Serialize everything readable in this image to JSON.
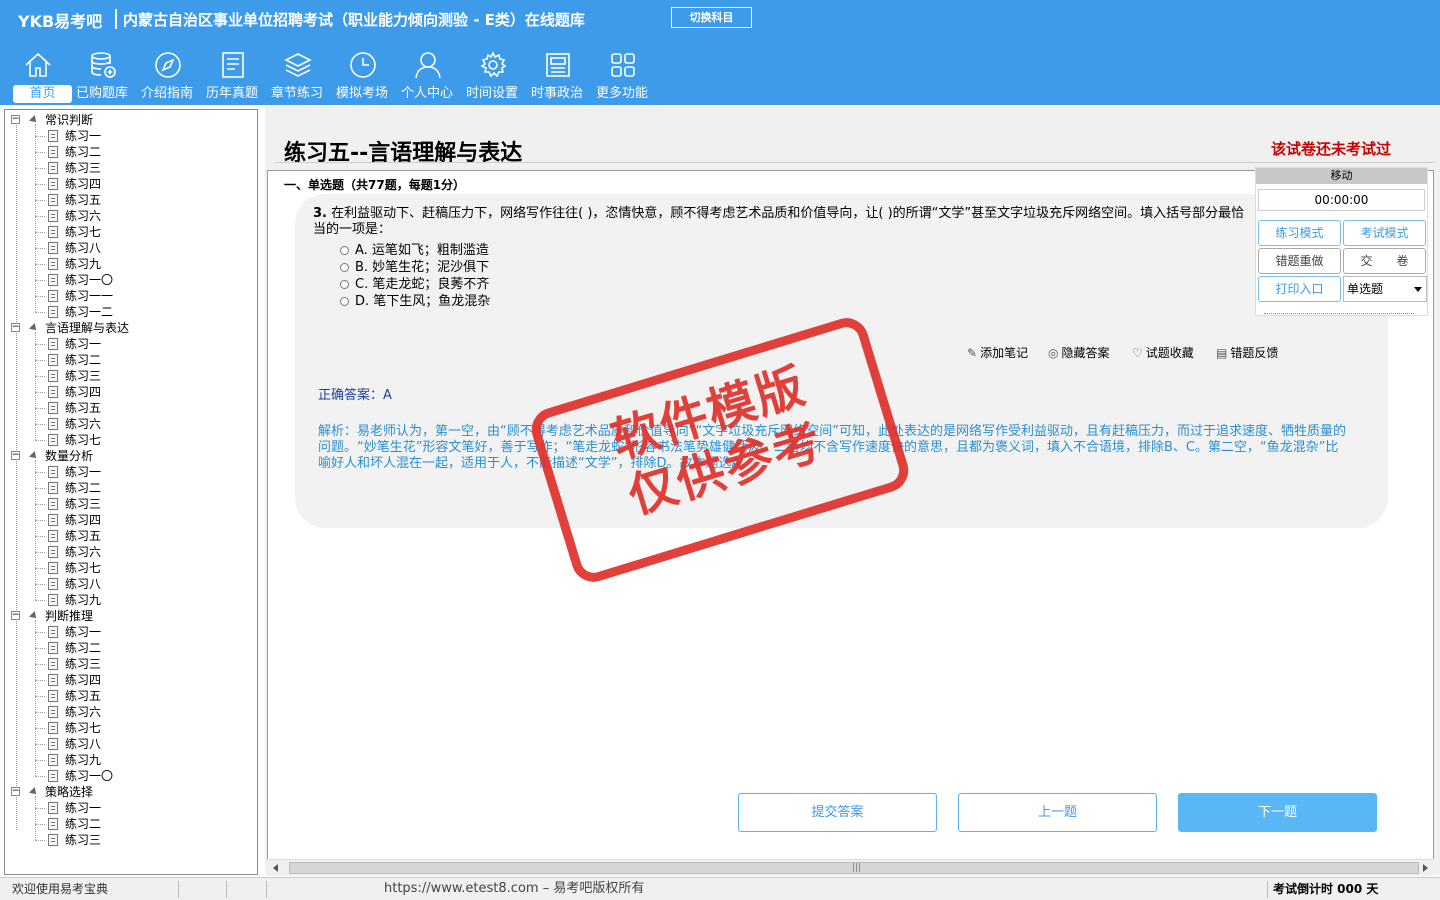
{
  "header": {
    "brand": "YKB易考吧",
    "title": "内蒙古自治区事业单位招聘考试（职业能力倾向测验 - E类）在线题库",
    "switch_label": "切换科目"
  },
  "nav": [
    {
      "label": "首页",
      "icon": "home-icon"
    },
    {
      "label": "已购题库",
      "icon": "database-icon"
    },
    {
      "label": "介绍指南",
      "icon": "compass-icon"
    },
    {
      "label": "历年真题",
      "icon": "list-doc-icon"
    },
    {
      "label": "章节练习",
      "icon": "layers-icon"
    },
    {
      "label": "模拟考场",
      "icon": "clock-icon"
    },
    {
      "label": "个人中心",
      "icon": "user-icon"
    },
    {
      "label": "时间设置",
      "icon": "gear-icon"
    },
    {
      "label": "时事政治",
      "icon": "news-icon"
    },
    {
      "label": "更多功能",
      "icon": "grid-icon"
    }
  ],
  "tree": [
    {
      "name": "常识判断",
      "children": [
        "练习一",
        "练习二",
        "练习三",
        "练习四",
        "练习五",
        "练习六",
        "练习七",
        "练习八",
        "练习九",
        "练习一〇",
        "练习一一",
        "练习一二"
      ]
    },
    {
      "name": "言语理解与表达",
      "children": [
        "练习一",
        "练习二",
        "练习三",
        "练习四",
        "练习五",
        "练习六",
        "练习七"
      ]
    },
    {
      "name": "数量分析",
      "children": [
        "练习一",
        "练习二",
        "练习三",
        "练习四",
        "练习五",
        "练习六",
        "练习七",
        "练习八",
        "练习九"
      ]
    },
    {
      "name": "判断推理",
      "children": [
        "练习一",
        "练习二",
        "练习三",
        "练习四",
        "练习五",
        "练习六",
        "练习七",
        "练习八",
        "练习九",
        "练习一〇"
      ]
    },
    {
      "name": "策略选择",
      "children": [
        "练习一",
        "练习二",
        "练习三"
      ]
    }
  ],
  "page": {
    "title": "练习五--言语理解与表达",
    "status": "该试卷还未考试过",
    "section": "一、单选题（共77题，每题1分）"
  },
  "question": {
    "number": "3.",
    "text": "在利益驱动下、赶稿压力下，网络写作往往(    )，恣情快意，顾不得考虑艺术品质和价值导向，让(    )的所谓“文学”甚至文字垃圾充斥网络空间。填入括号部分最恰当的一项是：",
    "options": [
      "A. 运笔如飞；粗制滥造",
      "B. 妙笔生花；泥沙俱下",
      "C. 笔走龙蛇；良莠不齐",
      "D. 笔下生风；鱼龙混杂"
    ]
  },
  "tools": {
    "note": "添加笔记",
    "hide": "隐藏答案",
    "favorite": "试题收藏",
    "feedback": "错题反馈"
  },
  "answer": "正确答案：A",
  "analysis": "解析：易老师认为，第一空，由“顾不得考虑艺术品质和价值导向”“文字垃圾充斥网络空间”可知，此处表达的是网络写作受利益驱动，且有赶稿压力，而过于追求速度、牺牲质量的问题。“妙笔生花”形容文笔好，善于写作；“笔走龙蛇”形容书法笔势雄健活泼。二者均不含写作速度快的意思，且都为褒义词，填入不合语境，排除B、C。第二空，“鱼龙混杂”比喻好人和坏人混在一起，适用于人，不能描述“文学”，排除D。故本题选A。",
  "side_panel": {
    "move": "移动",
    "timer": "00:00:00",
    "practice_mode": "练习模式",
    "exam_mode": "考试模式",
    "redo_wrong": "错题重做",
    "submit_paper": "交　　卷",
    "print": "打印入口",
    "qtype": "单选题"
  },
  "buttons": {
    "submit": "提交答案",
    "prev": "上一题",
    "next": "下一题"
  },
  "stamp": {
    "line1": "软件模版",
    "line2": "仅供参考"
  },
  "status": {
    "welcome": "欢迎使用易考宝典",
    "url": "https://www.etest8.com – 易考吧版权所有",
    "countdown": "考试倒计时 000 天"
  },
  "colors": {
    "header_bg": "#3d9be9",
    "stamp": "#e0302a",
    "analysis": "#2b8fce",
    "warning": "#cc0000"
  }
}
